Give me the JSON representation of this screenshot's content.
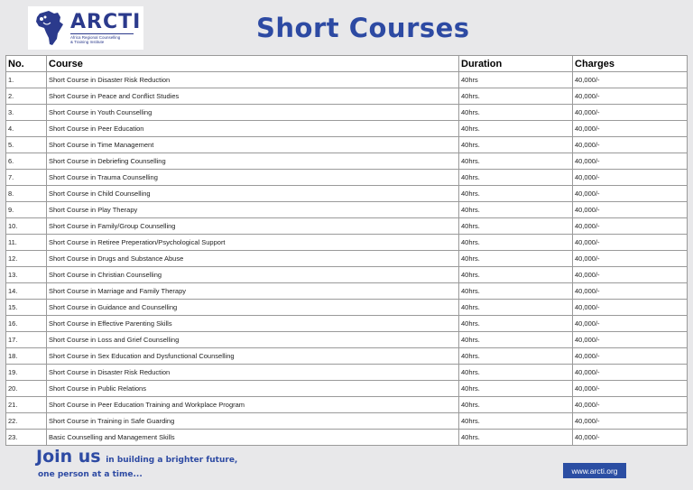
{
  "logo": {
    "name": "ARCTI",
    "tagline1": "Africa Regional Counselling",
    "tagline2": "& Training Institute",
    "colors": {
      "primary": "#2b3a8c",
      "accent": "#2d4aa3"
    }
  },
  "title": "Short Courses",
  "table": {
    "headers": [
      "No.",
      "Course",
      "Duration",
      "Charges"
    ],
    "rows": [
      [
        "1.",
        "Short Course in Disaster Risk Reduction",
        "40hrs",
        "40,000/-"
      ],
      [
        "2.",
        "Short Course in Peace and Conflict Studies",
        "40hrs.",
        "40,000/-"
      ],
      [
        "3.",
        "Short Course in Youth Counselling",
        "40hrs.",
        "40,000/-"
      ],
      [
        "4.",
        "Short Course in Peer Education",
        "40hrs.",
        "40,000/-"
      ],
      [
        "5.",
        "Short Course in Time Management",
        "40hrs.",
        "40,000/-"
      ],
      [
        "6.",
        "Short Course in Debriefing Counselling",
        "40hrs.",
        "40,000/-"
      ],
      [
        "7.",
        "Short Course in Trauma Counselling",
        "40hrs.",
        "40,000/-"
      ],
      [
        "8.",
        "Short Course in Child Counselling",
        "40hrs.",
        "40,000/-"
      ],
      [
        "9.",
        "Short Course in Play Therapy",
        "40hrs.",
        "40,000/-"
      ],
      [
        "10.",
        "Short Course in Family/Group Counselling",
        "40hrs.",
        "40,000/-"
      ],
      [
        "11.",
        "Short Course in Retiree Preperation/Psychological Support",
        "40hrs.",
        "40,000/-"
      ],
      [
        "12.",
        "Short Course in Drugs and Substance Abuse",
        "40hrs.",
        "40,000/-"
      ],
      [
        "13.",
        "Short Course in Christian Counselling",
        "40hrs.",
        "40,000/-"
      ],
      [
        "14.",
        "Short Course in Marriage and Family Therapy",
        "40hrs.",
        "40,000/-"
      ],
      [
        "15.",
        "Short Course in Guidance and Counselling",
        "40hrs.",
        "40,000/-"
      ],
      [
        "16.",
        "Short Course in Effective Parenting Skills",
        "40hrs.",
        "40,000/-"
      ],
      [
        "17.",
        "Short Course in Loss and Grief Counselling",
        "40hrs.",
        "40,000/-"
      ],
      [
        "18.",
        "Short Course in Sex Education and Dysfunctional Counselling",
        "40hrs.",
        "40,000/-"
      ],
      [
        "19.",
        "Short Course in Disaster Risk Reduction",
        "40hrs.",
        "40,000/-"
      ],
      [
        "20.",
        "Short Course in Public Relations",
        "40hrs.",
        "40,000/-"
      ],
      [
        "21.",
        "Short Course in Peer Education Training and Workplace Program",
        "40hrs.",
        "40,000/-"
      ],
      [
        "22.",
        "Short Course in Training in Safe Guarding",
        "40hrs.",
        "40,000/-"
      ],
      [
        "23.",
        "Basic Counselling and Management Skills",
        "40hrs.",
        "40,000/-"
      ]
    ]
  },
  "footer": {
    "join": "Join us",
    "join_rest": "in building a brighter future,",
    "line2": "one person at a  time...",
    "website": "www.arcti.org"
  }
}
